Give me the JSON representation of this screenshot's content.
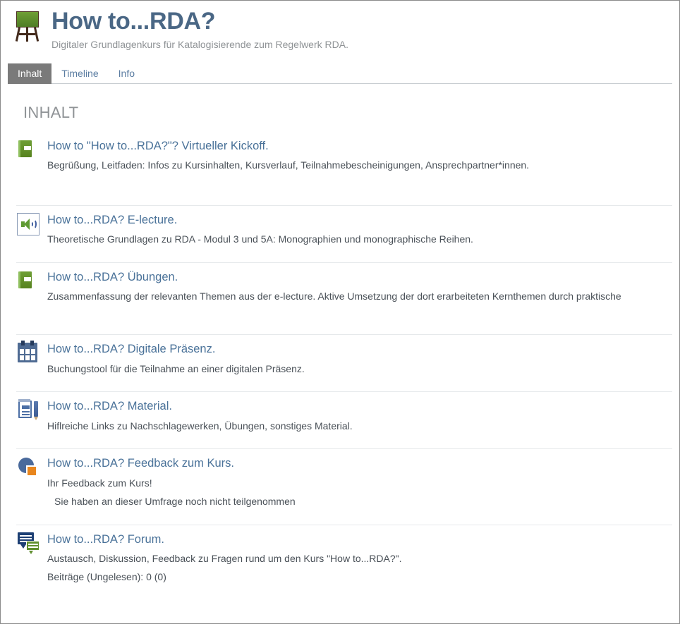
{
  "header": {
    "icon": "easel-chalkboard-icon",
    "title": "How to...RDA?",
    "summary": "Digitaler Grundlagenkurs für Katalogisierende zum Regelwerk RDA."
  },
  "tabs": [
    {
      "label": "Inhalt",
      "active": true
    },
    {
      "label": "Timeline",
      "active": false
    },
    {
      "label": "Info",
      "active": false
    }
  ],
  "content": {
    "section_title": "INHALT",
    "activities": [
      {
        "icon": "book-icon",
        "name": "How to \"How to...RDA?\"? Virtueller Kickoff.",
        "description": "Begrüßung, Leitfaden: Infos zu Kursinhalten, Kursverlauf, Teilnahmebescheinigungen, Ansprechpartner*innen.",
        "extra": ""
      },
      {
        "icon": "speaker-audio-icon",
        "name": "How to...RDA? E-lecture.",
        "description": "Theoretische Grundlagen zu RDA - Modul 3 und 5A: Monographien und monographische Reihen.",
        "extra": ""
      },
      {
        "icon": "book-icon",
        "name": "How to...RDA? Übungen.",
        "description": "Zusammenfassung der relevanten Themen aus der e-lecture. Aktive Umsetzung der dort erarbeiteten Kernthemen durch praktische",
        "extra": ""
      },
      {
        "icon": "calendar-icon",
        "name": "How to...RDA? Digitale Präsenz.",
        "description": "Buchungstool für die Teilnahme an einer digitalen Präsenz.",
        "extra": ""
      },
      {
        "icon": "page-document-icon",
        "name": "How to...RDA? Material.",
        "description": "Hiflreiche Links zu Nachschlagewerken, Übungen, sonstiges Material.",
        "extra": ""
      },
      {
        "icon": "pie-chart-feedback-icon",
        "name": "How to...RDA? Feedback zum Kurs.",
        "description": "Ihr Feedback zum Kurs!",
        "extra": "Sie haben an dieser Umfrage noch nicht teilgenommen"
      },
      {
        "icon": "forum-icon",
        "name": "How to...RDA? Forum.",
        "description": "Austausch, Diskussion, Feedback zu Fragen rund um den Kurs \"How to...RDA?\".",
        "extra": "Beiträge (Ungelesen): 0 (0)"
      }
    ]
  },
  "colors": {
    "link": "#4a7299",
    "title": "#4a6785",
    "muted": "#8f9396",
    "tab_active_bg": "#7a7a7a",
    "divider": "#e6e9eb",
    "board_green": "#6f9f35"
  }
}
